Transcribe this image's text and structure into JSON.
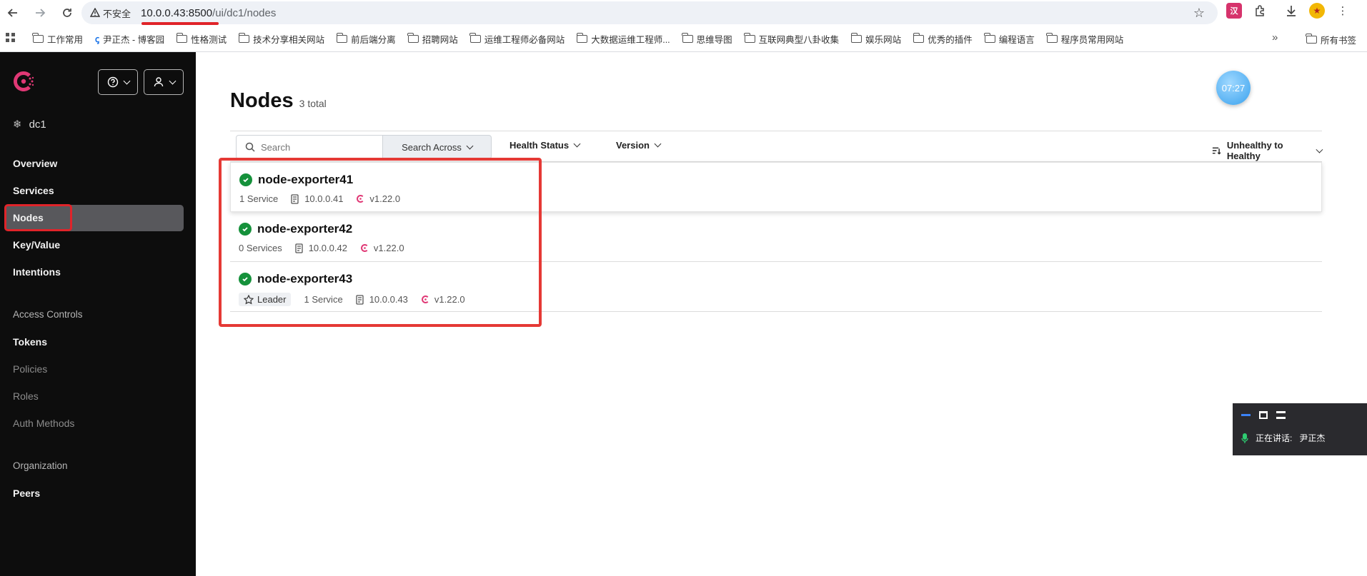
{
  "browser": {
    "insecure_label": "不安全",
    "url_host": "10.0.0.43:8500",
    "url_path": "/ui/dc1/nodes",
    "bookmarks": [
      "工作常用",
      "尹正杰 - 博客园",
      "性格测试",
      "技术分享相关网站",
      "前后端分离",
      "招聘网站",
      "运维工程师必备网站",
      "大数据运维工程师...",
      "思维导图",
      "互联网典型八卦收集",
      "娱乐网站",
      "优秀的插件",
      "编程语言",
      "程序员常用网站"
    ],
    "all_bookmarks": "所有书签",
    "ext_badge": "汉"
  },
  "sidebar": {
    "datacenter": "dc1",
    "items": {
      "overview": "Overview",
      "services": "Services",
      "nodes": "Nodes",
      "key_value": "Key/Value",
      "intentions": "Intentions",
      "access_controls": "Access Controls",
      "tokens": "Tokens",
      "policies": "Policies",
      "roles": "Roles",
      "auth_methods": "Auth Methods",
      "organization": "Organization",
      "peers": "Peers"
    }
  },
  "main": {
    "title": "Nodes",
    "count": "3 total",
    "clock": "07:27",
    "search_placeholder": "Search",
    "search_across": "Search Across",
    "health_status": "Health Status",
    "version": "Version",
    "sort": "Unhealthy to Healthy",
    "nodes": [
      {
        "name": "node-exporter41",
        "leader": "",
        "services": "1 Service",
        "address": "10.0.0.41",
        "version": "v1.22.0"
      },
      {
        "name": "node-exporter42",
        "leader": "",
        "services": "0 Services",
        "address": "10.0.0.42",
        "version": "v1.22.0"
      },
      {
        "name": "node-exporter43",
        "leader": "Leader",
        "services": "1 Service",
        "address": "10.0.0.43",
        "version": "v1.22.0"
      }
    ]
  },
  "widget": {
    "speaking_label": "正在讲话:",
    "speaker": "尹正杰"
  },
  "colors": {
    "sidebar_bg": "#0d0d0d",
    "consul_brand": "#e03875",
    "healthy": "#15913b",
    "highlight": "#e53935"
  }
}
